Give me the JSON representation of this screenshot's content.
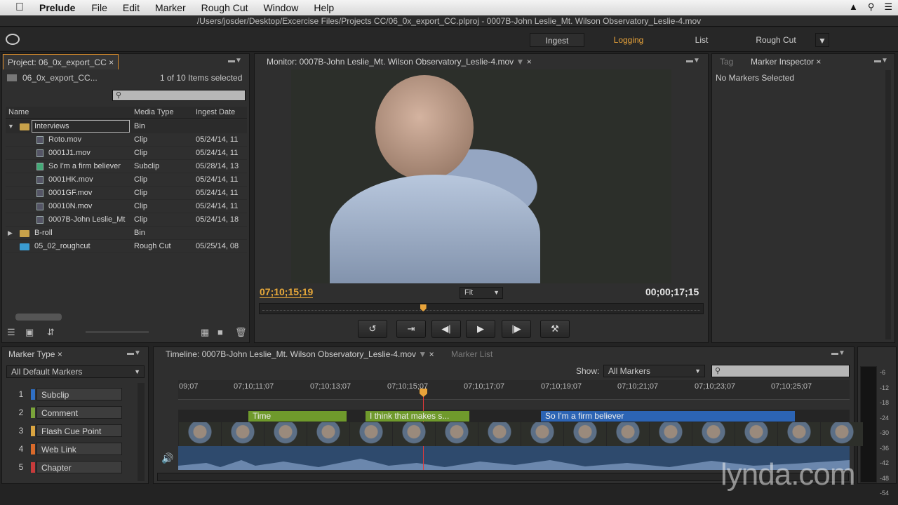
{
  "menubar": {
    "app": "Prelude",
    "items": [
      "File",
      "Edit",
      "Marker",
      "Rough Cut",
      "Window",
      "Help"
    ]
  },
  "window": {
    "title": "/Users/josder/Desktop/Excercise Files/Projects CC/06_0x_export_CC.plproj - 0007B-John Leslie_Mt. Wilson Observatory_Leslie-4.mov"
  },
  "workspaces": {
    "ingest": "Ingest",
    "logging": "Logging",
    "list": "List",
    "roughcut": "Rough Cut"
  },
  "project": {
    "tab": "Project: 06_0x_export_CC",
    "name": "06_0x_export_CC...",
    "selection": "1 of 10 Items selected",
    "columns": [
      "Name",
      "Media Type",
      "Ingest Date"
    ],
    "rows": [
      {
        "name": "Interviews",
        "type": "Bin",
        "date": "",
        "kind": "bin-open"
      },
      {
        "name": "Roto.mov",
        "type": "Clip",
        "date": "05/24/14, 11",
        "kind": "clip"
      },
      {
        "name": "0001J1.mov",
        "type": "Clip",
        "date": "05/24/14, 11",
        "kind": "clip"
      },
      {
        "name": "So I'm a firm believer",
        "type": "Subclip",
        "date": "05/28/14, 13",
        "kind": "subclip"
      },
      {
        "name": "0001HK.mov",
        "type": "Clip",
        "date": "05/24/14, 11",
        "kind": "clip"
      },
      {
        "name": "0001GF.mov",
        "type": "Clip",
        "date": "05/24/14, 11",
        "kind": "clip"
      },
      {
        "name": "00010N.mov",
        "type": "Clip",
        "date": "05/24/14, 11",
        "kind": "clip"
      },
      {
        "name": "0007B-John Leslie_Mt",
        "type": "Clip",
        "date": "05/24/14, 18",
        "kind": "clip"
      },
      {
        "name": "B-roll",
        "type": "Bin",
        "date": "",
        "kind": "bin-closed"
      },
      {
        "name": "05_02_roughcut",
        "type": "Rough Cut",
        "date": "05/25/14, 08",
        "kind": "roughcut"
      }
    ]
  },
  "monitor": {
    "tab": "Monitor: 0007B-John Leslie_Mt. Wilson Observatory_Leslie-4.mov",
    "timecode_current": "07;10;15;19",
    "zoom": "Fit",
    "timecode_duration": "00;00;17;15",
    "playhead_fraction": 0.367
  },
  "inspector": {
    "tab_tag": "Tag",
    "tab_inspector": "Marker Inspector",
    "message": "No Markers Selected"
  },
  "marker_type": {
    "tab": "Marker Type",
    "filter": "All Default Markers",
    "items": [
      {
        "num": "1",
        "label": "Subclip",
        "color": "#2f6fc4"
      },
      {
        "num": "2",
        "label": "Comment",
        "color": "#7aa33a"
      },
      {
        "num": "3",
        "label": "Flash Cue Point",
        "color": "#d9a441"
      },
      {
        "num": "4",
        "label": "Web Link",
        "color": "#d96a2b"
      },
      {
        "num": "5",
        "label": "Chapter",
        "color": "#c73b3b"
      }
    ]
  },
  "timeline": {
    "tab": "Timeline: 0007B-John Leslie_Mt. Wilson Observatory_Leslie-4.mov",
    "tab2": "Marker List",
    "show_label": "Show:",
    "show_value": "All Markers",
    "ticks": [
      "09;07",
      "07;10;11;07",
      "07;10;13;07",
      "07;10;15;07",
      "07;10;17;07",
      "07;10;19;07",
      "07;10;21;07",
      "07;10;23;07",
      "07;10;25;07"
    ],
    "markers": [
      {
        "label": "Time",
        "color": "#6f9a2c"
      },
      {
        "label": "I think that makes s...",
        "color": "#6f9a2c"
      },
      {
        "label": "So I'm a firm believer",
        "color": "#2c64b4"
      }
    ]
  },
  "meter": {
    "labels": [
      "-6",
      "-12",
      "-18",
      "-24",
      "-30",
      "-36",
      "-42",
      "-48",
      "-54"
    ]
  },
  "watermark": "lynda.com"
}
